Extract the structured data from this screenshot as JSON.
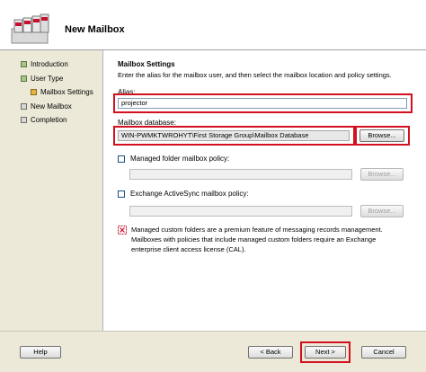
{
  "header": {
    "title": "New Mailbox",
    "icon": "mailbox-wizard-icon"
  },
  "nav": {
    "items": [
      {
        "label": "Introduction",
        "state": "done"
      },
      {
        "label": "User Type",
        "state": "done"
      },
      {
        "label": "Mailbox Settings",
        "state": "current"
      },
      {
        "label": "New Mailbox",
        "state": "pending"
      },
      {
        "label": "Completion",
        "state": "pending"
      }
    ]
  },
  "main": {
    "section_title": "Mailbox Settings",
    "description": "Enter the alias for the mailbox user, and then select the mailbox location and policy settings.",
    "alias_label": "Alias:",
    "alias_value": "projector",
    "database_label": "Mailbox database:",
    "database_value": "WIN-PWMKTWROHYT\\First Storage Group\\Mailbox Database",
    "browse_label": "Browse...",
    "managed_folder_label": "Managed folder mailbox policy:",
    "activesync_label": "Exchange ActiveSync mailbox policy:",
    "info_lines": [
      "Managed custom folders are a premium feature of messaging records management.",
      "Mailboxes with policies that include managed custom folders require an Exchange",
      "enterprise client access license (CAL)."
    ]
  },
  "footer": {
    "help_label": "Help",
    "back_label": "< Back",
    "next_label": "Next >",
    "cancel_label": "Cancel"
  },
  "colors": {
    "highlight": "#d2101f",
    "current_step": "#e2b640",
    "done_step": "#aac38a"
  }
}
